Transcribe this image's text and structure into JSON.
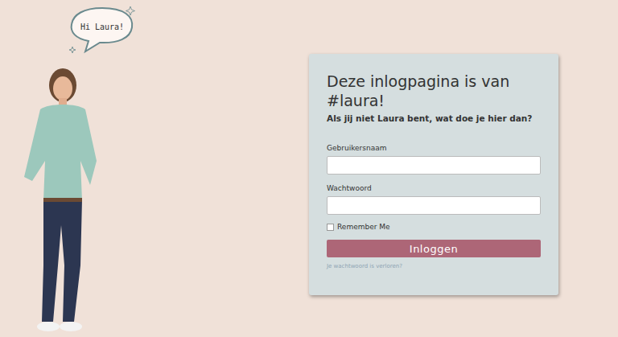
{
  "bubble": "Hi Laura!",
  "login": {
    "title": "Deze inlogpagina is van #laura!",
    "subtitle": "Als jij niet Laura bent, wat doe je hier dan?",
    "username_label": "Gebruikersnaam",
    "password_label": "Wachtwoord",
    "remember": {
      "label": "Remember Me",
      "checked": false
    },
    "button": "Inloggen",
    "lost_password": "Je wachtwoord is verloren?"
  }
}
